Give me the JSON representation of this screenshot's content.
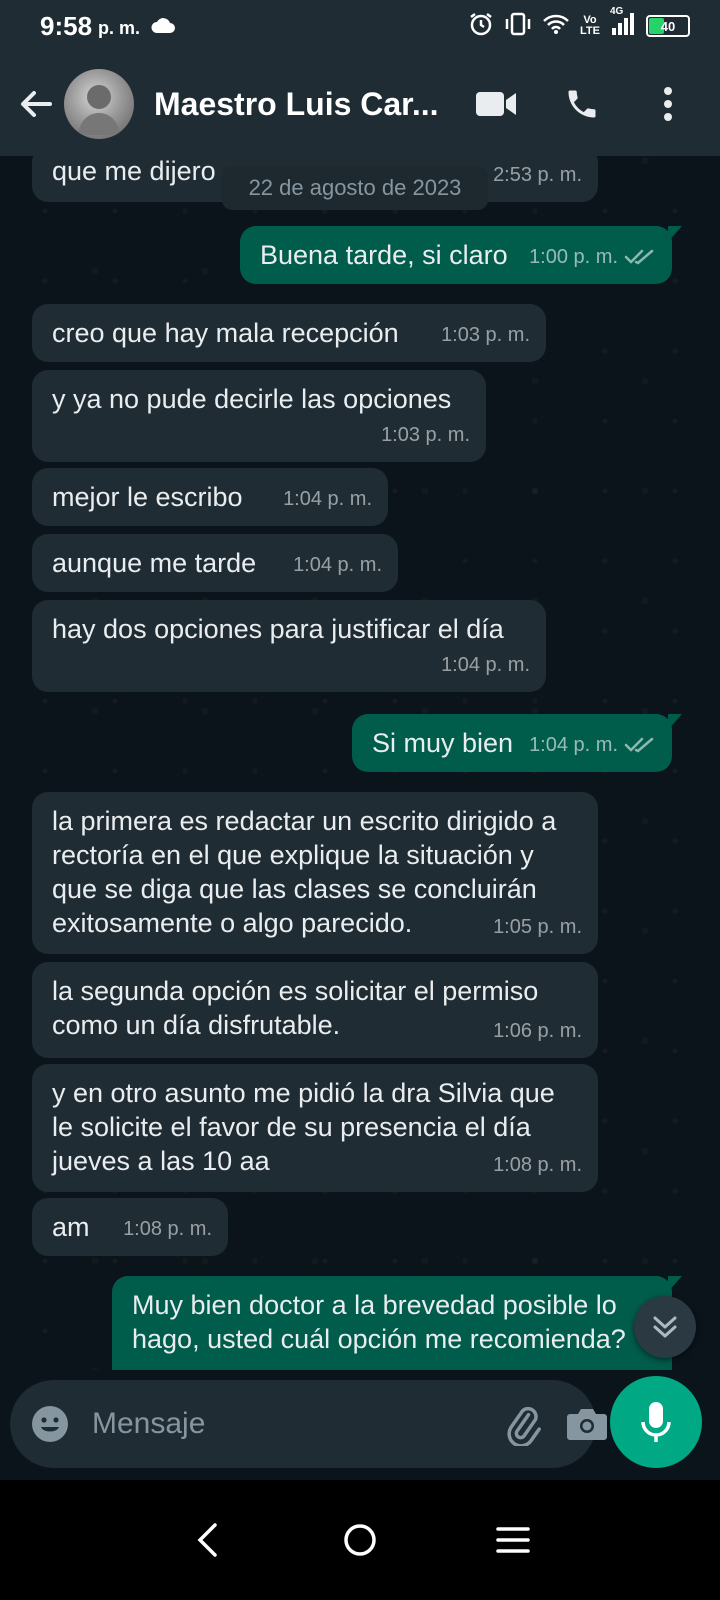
{
  "status_bar": {
    "time": "9:58",
    "ampm": "p. m.",
    "network_top": "Vo",
    "network_bottom": "LTE",
    "network_gen": "4G",
    "battery": "40",
    "icons": [
      "cloud-icon",
      "alarm-icon",
      "vibrate-icon",
      "wifi-icon",
      "signal-icon",
      "battery-icon"
    ]
  },
  "header": {
    "contact_name": "Maestro Luis Car...",
    "icons": [
      "back-arrow-icon",
      "video-call-icon",
      "phone-icon",
      "more-vert-icon"
    ]
  },
  "chat": {
    "date_separator": "22 de agosto de 2023",
    "messages": [
      {
        "dir": "in",
        "text": "que me dijero",
        "time": "2:53 p. m."
      },
      {
        "dir": "out",
        "text": "Buena tarde, si claro",
        "time": "1:00 p. m.",
        "read": true
      },
      {
        "dir": "in",
        "text": "creo que hay mala recepción",
        "time": "1:03 p. m."
      },
      {
        "dir": "in",
        "text": "y ya no pude decirle las opciones",
        "time": "1:03 p. m."
      },
      {
        "dir": "in",
        "text": "mejor le escribo",
        "time": "1:04 p. m."
      },
      {
        "dir": "in",
        "text": "aunque me tarde",
        "time": "1:04 p. m."
      },
      {
        "dir": "in",
        "text": "hay dos opciones para justificar el día",
        "time": "1:04 p. m."
      },
      {
        "dir": "out",
        "text": "Si muy bien",
        "time": "1:04 p. m.",
        "read": true
      },
      {
        "dir": "in",
        "text": "la primera es redactar un escrito dirigido a rectoría en el que explique la situación y que se diga que las clases se concluirán exitosamente o algo parecido.",
        "time": "1:05 p. m."
      },
      {
        "dir": "in",
        "text": "la segunda opción es solicitar el permiso como un día disfrutable.",
        "time": "1:06 p. m."
      },
      {
        "dir": "in",
        "text": "y en otro asunto me pidió la dra Silvia que le solicite el favor de su presencia el día jueves a las 10 aa",
        "time": "1:08 p. m."
      },
      {
        "dir": "in",
        "text": "am",
        "time": "1:08 p. m."
      },
      {
        "dir": "out",
        "text": "Muy bien doctor a la brevedad posible lo hago, usted cuál opción me recomienda?",
        "time": ""
      }
    ]
  },
  "composer": {
    "placeholder": "Mensaje",
    "icons": [
      "emoji-icon",
      "attach-icon",
      "camera-icon",
      "mic-icon"
    ]
  },
  "nav": {
    "icons": [
      "nav-back-icon",
      "nav-home-icon",
      "nav-recents-icon"
    ]
  },
  "colors": {
    "background": "#0b141a",
    "bar": "#1f2c34",
    "incoming_bubble": "#202c33",
    "outgoing_bubble": "#005c4b",
    "accent": "#00a884",
    "read_ticks": "#53bdeb"
  }
}
